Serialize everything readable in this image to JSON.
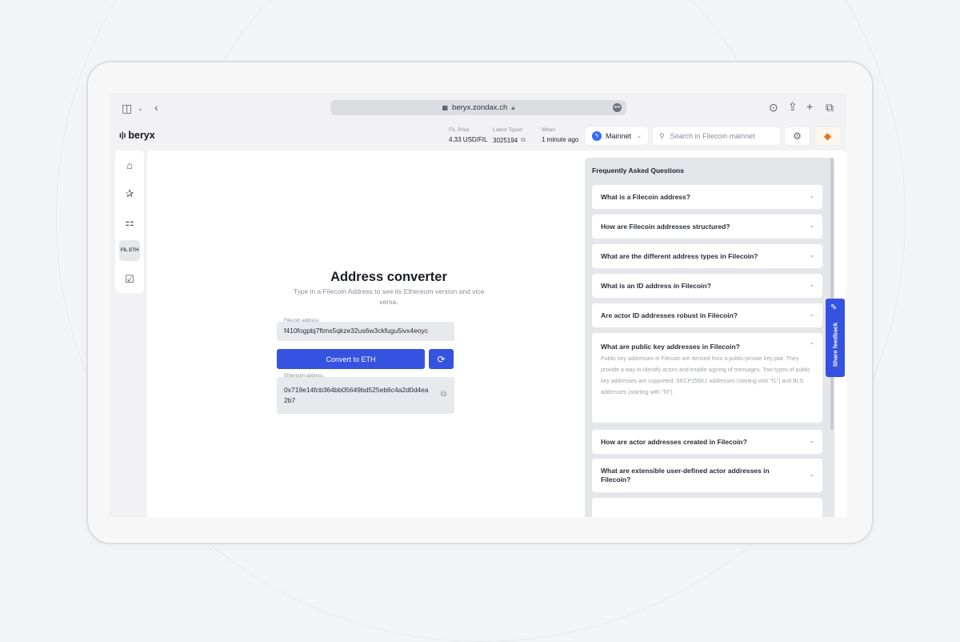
{
  "browser": {
    "url": "beryx.zondax.ch"
  },
  "header": {
    "logo": "beryx",
    "fil_price": {
      "label": "FIL Price",
      "value": "4.33 USD/FIL"
    },
    "latest_tipset": {
      "label": "Latest Tipset",
      "value": "3025194"
    },
    "when": {
      "label": "When",
      "value": "1 minute ago"
    },
    "network": "Mainnet",
    "search_placeholder": "Search in Filecoin mainnet"
  },
  "sidebar": {
    "items": [
      {
        "icon": "home-icon"
      },
      {
        "icon": "clipboard-star-icon"
      },
      {
        "icon": "tree-icon"
      },
      {
        "icon": "fil-eth-icon",
        "label": "FIL ETH",
        "active": true
      },
      {
        "icon": "checklist-icon"
      }
    ]
  },
  "converter": {
    "title": "Address converter",
    "subtitle": "Type in a Filecoin Address to see its Ethereum version and vice versa.",
    "filecoin_label": "Filecoin address",
    "filecoin_value": "f410fogpbj7ftms5qkze32us6w3ckfugu5ivx4eoyc",
    "convert_label": "Convert to ETH",
    "ethereum_label": "Ethereum address",
    "ethereum_value": "0x719e14fcb364bb05649bd525eb6c4a2d0d4ea2b7"
  },
  "faq": {
    "title": "Frequently Asked Questions",
    "items": [
      {
        "q": "What is a Filecoin address?"
      },
      {
        "q": "How are Filecoin addresses structured?"
      },
      {
        "q": "What are the different address types in Filecoin?"
      },
      {
        "q": "What is an ID address in Filecoin?"
      },
      {
        "q": "Are actor ID addresses robust in Filecoin?"
      },
      {
        "q": "What are public key addresses in Filecoin?",
        "a": "Public key addresses in Filecoin are derived from a public-private key pair. They provide a way to identify actors and enable signing of messages. Two types of public key addresses are supported: SECP256K1 addresses (starting with \"f1\") and BLS addresses (starting with \"f3\")."
      },
      {
        "q": "How are actor addresses created in Filecoin?"
      },
      {
        "q": "What are extensible user-defined actor addresses in Filecoin?"
      }
    ]
  },
  "feedback": {
    "label": "Share feedback"
  }
}
